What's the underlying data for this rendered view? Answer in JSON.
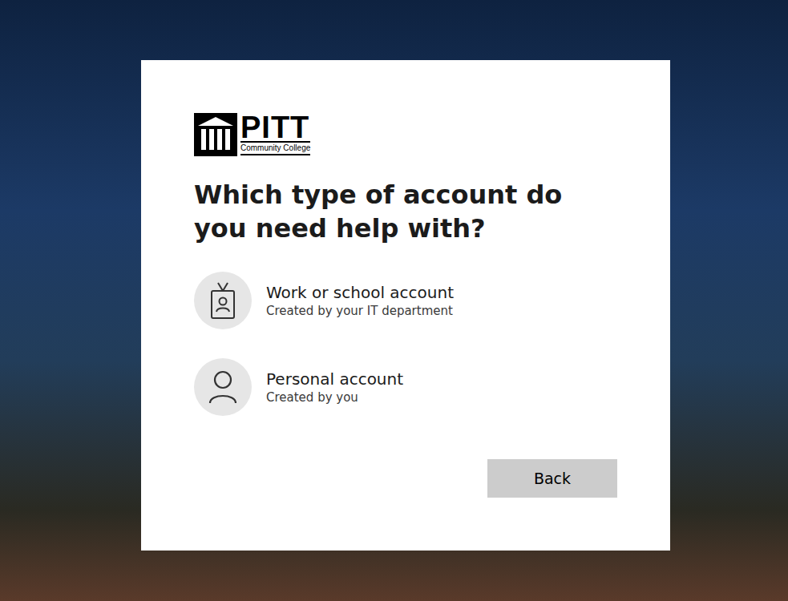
{
  "logo": {
    "name": "PITT",
    "subtitle": "Community College"
  },
  "heading": "Which type of account do you need help with?",
  "options": [
    {
      "title": "Work or school account",
      "subtitle": "Created by your IT department",
      "kind": "work"
    },
    {
      "title": "Personal account",
      "subtitle": "Created by you",
      "kind": "personal"
    }
  ],
  "buttons": [
    "Back"
  ]
}
